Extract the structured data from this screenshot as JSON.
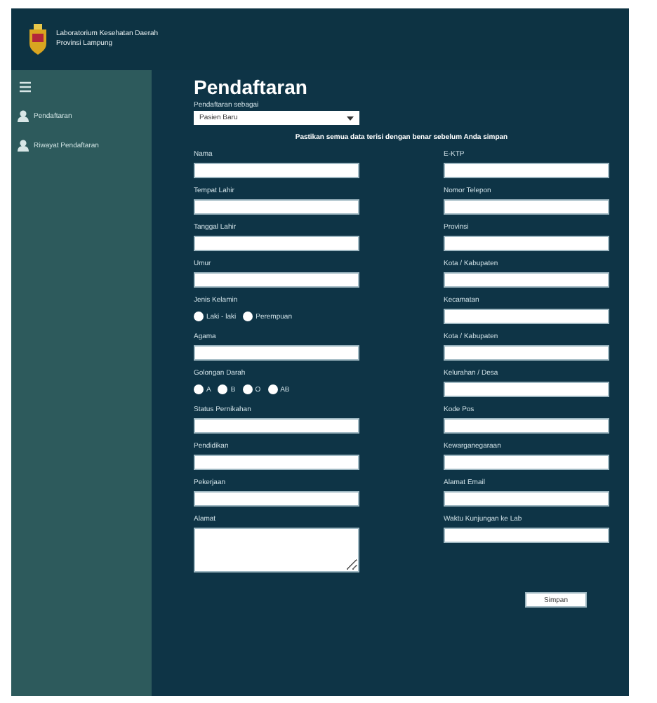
{
  "header": {
    "title_line_1": "Laboratorium Kesehatan Daerah",
    "title_line_2": "Provinsi Lampung"
  },
  "sidebar": {
    "items": [
      {
        "label": "Pendaftaran",
        "selected": false
      },
      {
        "label": "Riwayat Pendaftaran",
        "selected": false
      }
    ]
  },
  "page_title": "Pendaftaran",
  "registration_type": {
    "label": "Pendaftaran sebagai",
    "value": "Pasien Baru"
  },
  "notice": "Pastikan semua data terisi dengan benar sebelum Anda simpan",
  "left_fields": [
    {
      "label": "Nama",
      "kind": "text"
    },
    {
      "label": "Tempat Lahir",
      "kind": "text"
    },
    {
      "label": "Tanggal Lahir",
      "kind": "text"
    },
    {
      "label": "Umur",
      "kind": "text"
    },
    {
      "label": "Jenis Kelamin",
      "kind": "radio",
      "options": [
        {
          "label": "Laki - laki",
          "selected": false
        },
        {
          "label": "Perempuan",
          "selected": false
        }
      ]
    },
    {
      "label": "Agama",
      "kind": "text"
    },
    {
      "label": "Golongan Darah",
      "kind": "radio",
      "options": [
        {
          "label": "A",
          "selected": false
        },
        {
          "label": "B",
          "selected": false
        },
        {
          "label": "O",
          "selected": false
        },
        {
          "label": "AB",
          "selected": false
        }
      ]
    },
    {
      "label": "Status Pernikahan",
      "kind": "text"
    },
    {
      "label": "Pendidikan",
      "kind": "text"
    },
    {
      "label": "Pekerjaan",
      "kind": "text"
    },
    {
      "label": "Alamat",
      "kind": "textarea"
    }
  ],
  "right_fields": [
    {
      "label": "E-KTP",
      "kind": "text"
    },
    {
      "label": "Nomor Telepon",
      "kind": "text"
    },
    {
      "label": "Provinsi",
      "kind": "text"
    },
    {
      "label": "Kota / Kabupaten",
      "kind": "text"
    },
    {
      "label": "Kecamatan",
      "kind": "text"
    },
    {
      "label": "Kota / Kabupaten",
      "kind": "text"
    },
    {
      "label": "Kelurahan / Desa",
      "kind": "text"
    },
    {
      "label": "Kode Pos",
      "kind": "text"
    },
    {
      "label": "Kewarganegaraan",
      "kind": "text"
    },
    {
      "label": "Alamat Email",
      "kind": "text"
    },
    {
      "label": "Waktu Kunjungan ke Lab",
      "kind": "text"
    }
  ],
  "save_button": "Simpan"
}
